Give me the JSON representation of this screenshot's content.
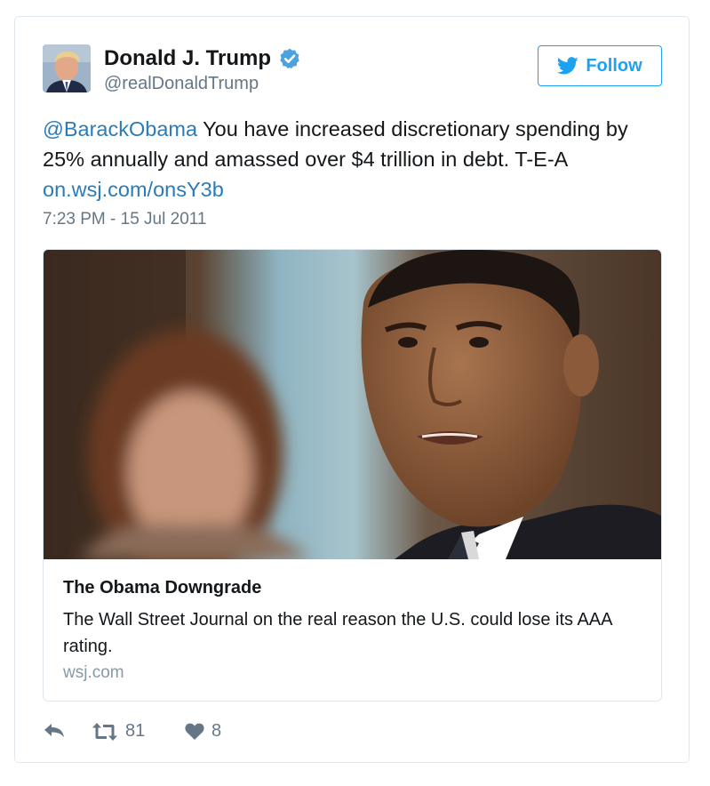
{
  "user": {
    "display_name": "Donald J. Trump",
    "screen_name": "@realDonaldTrump",
    "verified": true
  },
  "follow_button": {
    "label": "Follow",
    "icon": "twitter-bird-icon"
  },
  "tweet": {
    "mention": "@BarackObama",
    "text_line": " You have increased discretionary spending by 25% annually and amassed over $4 trillion in debt. T-E-A",
    "link": "on.wsj.com/onsY3b",
    "timestamp": "7:23 PM - 15 Jul 2011"
  },
  "card": {
    "title": "The Obama Downgrade",
    "description": "The Wall Street Journal on the real reason the U.S. could lose its AAA rating.",
    "domain": "wsj.com"
  },
  "actions": {
    "reply_icon": "reply-icon",
    "retweet_icon": "retweet-icon",
    "retweet_count": "81",
    "like_icon": "heart-icon",
    "like_count": "8"
  },
  "colors": {
    "link": "#2b7bb9",
    "accent": "#1da1f2",
    "secondary_text": "#657786",
    "border": "#e1e8ed"
  }
}
